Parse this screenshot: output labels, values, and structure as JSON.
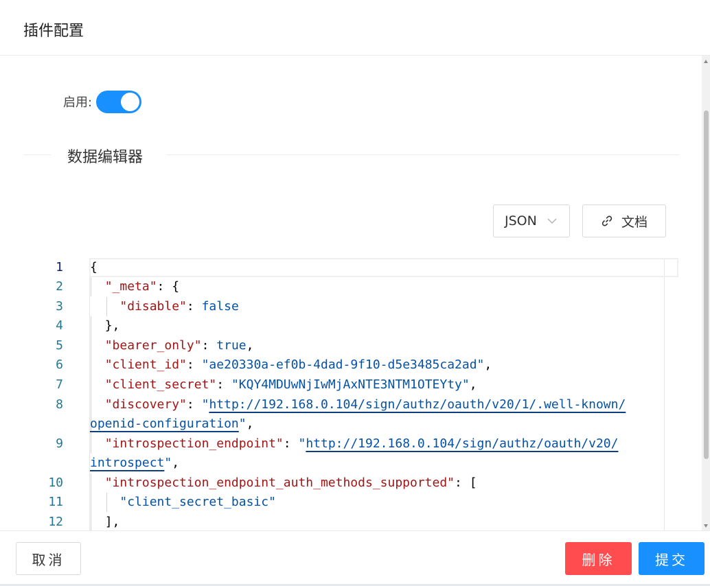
{
  "dialog": {
    "title": "插件配置"
  },
  "enable": {
    "label": "启用:",
    "on": true
  },
  "section": {
    "title": "数据编辑器"
  },
  "editor_toolbar": {
    "format_value": "JSON",
    "doc_label": "文档"
  },
  "editor": {
    "line_numbers": [
      "1",
      "2",
      "3",
      "4",
      "5",
      "6",
      "7",
      "8",
      "9",
      "10",
      "11",
      "12"
    ],
    "lines": {
      "l1": {
        "brace": "{"
      },
      "l2": {
        "key": "\"_meta\"",
        "rest": ": {"
      },
      "l3": {
        "key": "\"disable\"",
        "sep": ": ",
        "value": "false"
      },
      "l4": {
        "text": "},"
      },
      "l5": {
        "key": "\"bearer_only\"",
        "sep": ": ",
        "value": "true",
        "end": ","
      },
      "l6": {
        "key": "\"client_id\"",
        "sep": ": ",
        "value": "\"ae20330a-ef0b-4dad-9f10-d5e3485ca2ad\"",
        "end": ","
      },
      "l7": {
        "key": "\"client_secret\"",
        "sep": ": ",
        "value": "\"KQY4MDUwNjIwMjAxNTE3NTM1OTEYty\"",
        "end": ","
      },
      "l8": {
        "key": "\"discovery\"",
        "sep": ": ",
        "q1": "\"",
        "url_a": "http://192.168.0.104/sign/authz/oauth/v20/1/.well-known/",
        "url_b": "openid-configuration",
        "q2": "\"",
        "end": ","
      },
      "l9": {
        "key": "\"introspection_endpoint\"",
        "sep": ": ",
        "q1": "\"",
        "url_a": "http://192.168.0.104/sign/authz/oauth/v20/",
        "url_b": "introspect",
        "q2": "\"",
        "end": ","
      },
      "l10": {
        "key": "\"introspection_endpoint_auth_methods_supported\"",
        "rest": ": ["
      },
      "l11": {
        "value": "\"client_secret_basic\""
      },
      "l12": {
        "text": "],"
      }
    }
  },
  "footer": {
    "cancel_label": "取消",
    "delete_label": "删除",
    "submit_label": "提交"
  },
  "colors": {
    "primary": "#1890ff",
    "danger": "#ff4d4f",
    "json_key": "#a31515",
    "json_value": "#0451a5",
    "line_number": "#237893"
  }
}
